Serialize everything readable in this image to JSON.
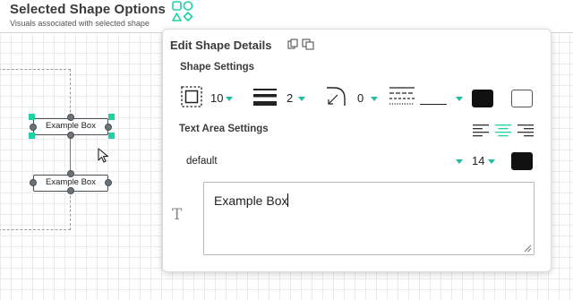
{
  "header": {
    "title": "Selected Shape Options",
    "subtitle": "Visuals associated with selected shape",
    "shapes_icon": "shapes-icon"
  },
  "canvas": {
    "boxes": [
      {
        "label": "Example Box",
        "selected": true
      },
      {
        "label": "Example Box",
        "selected": false
      }
    ]
  },
  "panel": {
    "title": "Edit Shape Details",
    "icons": [
      "copy-icon",
      "duplicate-icon"
    ],
    "shape_settings": {
      "title": "Shape Settings",
      "padding": "10",
      "border_width": "2",
      "corner_radius": "0",
      "border_style": "",
      "border_color": "#111111",
      "fill_color": "#ffffff"
    },
    "text_area_settings": {
      "title": "Text Area Settings",
      "alignments": [
        "align-left",
        "align-center",
        "align-right"
      ],
      "active_alignment": "align-center",
      "font": "default",
      "font_size": "14",
      "text_color": "#111111"
    },
    "text": {
      "icon": "text-icon",
      "icon_glyph": "T",
      "value": "Example Box"
    }
  },
  "colors": {
    "accent": "#1ed3a2",
    "caret": "#1ebfa0"
  }
}
